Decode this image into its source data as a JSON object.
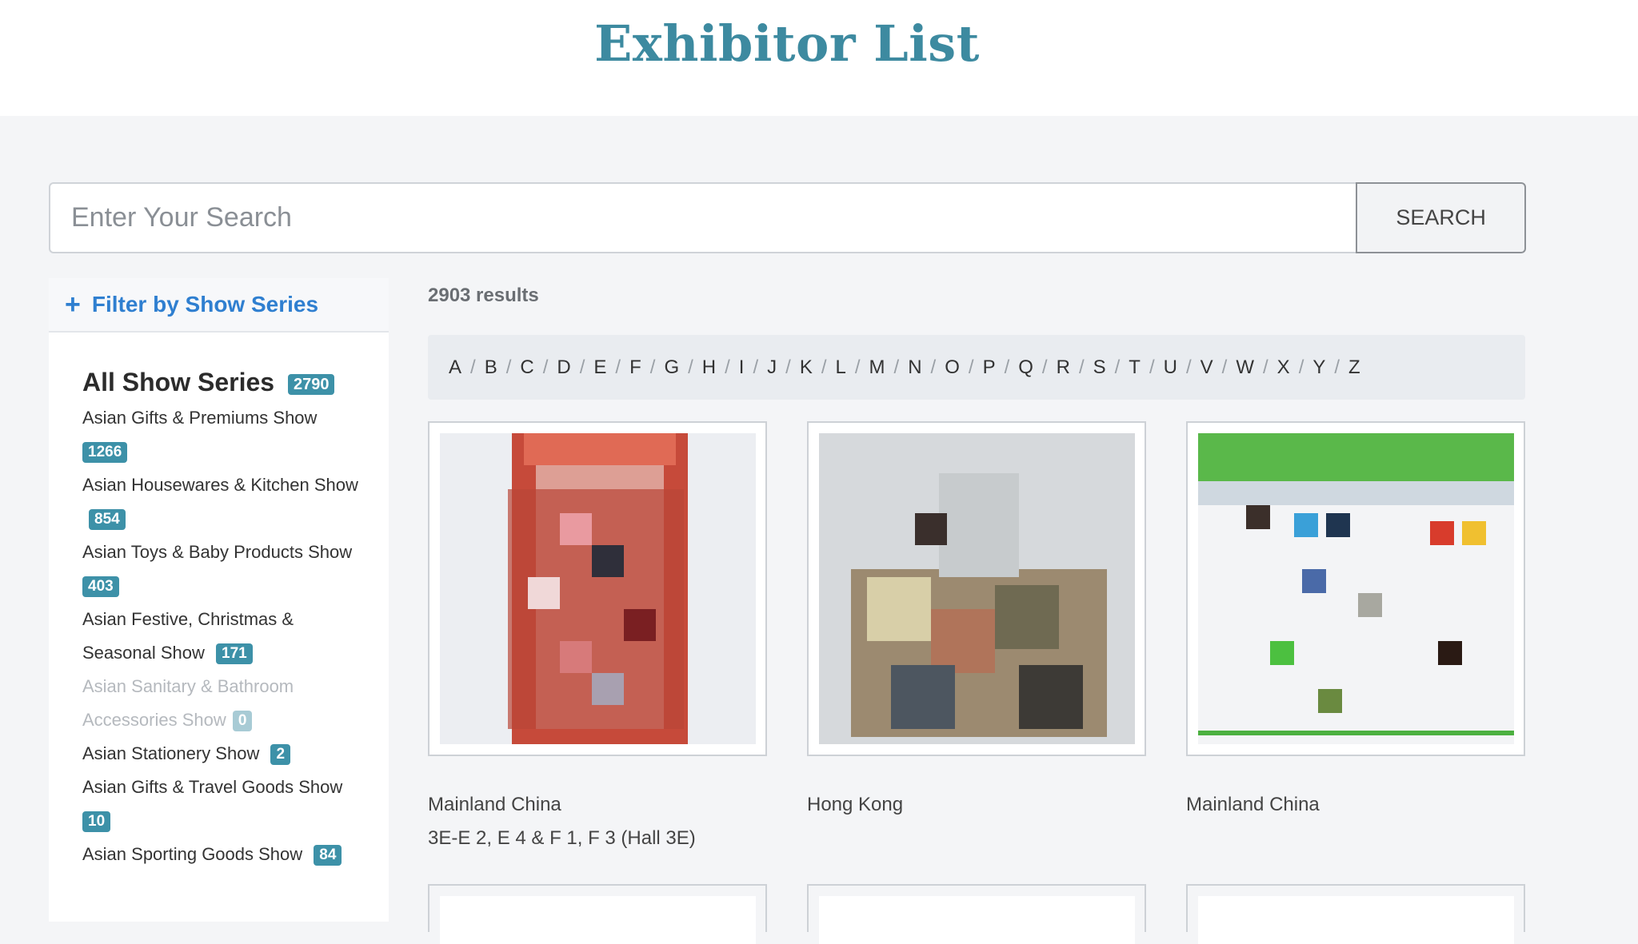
{
  "header": {
    "title": "Exhibitor List"
  },
  "search": {
    "placeholder": "Enter Your Search",
    "button_label": "SEARCH"
  },
  "sidebar": {
    "filter_label": "Filter by Show Series",
    "all_series": {
      "label": "All Show Series",
      "count": "2790"
    },
    "series": [
      {
        "label": "Asian Gifts & Premiums Show",
        "count": "1266"
      },
      {
        "label": "Asian Housewares & Kitchen Show",
        "count": "854"
      },
      {
        "label": "Asian Toys & Baby Products Show",
        "count": "403"
      },
      {
        "label": "Asian Festive, Christmas & Seasonal Show",
        "count": "171"
      },
      {
        "label": "Asian Sanitary & Bathroom Accessories Show",
        "count": "0"
      },
      {
        "label": "Asian Stationery Show",
        "count": "2"
      },
      {
        "label": "Asian Gifts & Travel Goods Show",
        "count": "10"
      },
      {
        "label": "Asian Sporting Goods Show",
        "count": "84"
      }
    ]
  },
  "results": {
    "count_text": "2903 results"
  },
  "alphabet": [
    "A",
    "B",
    "C",
    "D",
    "E",
    "F",
    "G",
    "H",
    "I",
    "J",
    "K",
    "L",
    "M",
    "N",
    "O",
    "P",
    "Q",
    "R",
    "S",
    "T",
    "U",
    "V",
    "W",
    "X",
    "Y",
    "Z"
  ],
  "cards": [
    {
      "region": "Mainland China",
      "booth": "3E-E 2, E 4 & F 1, F 3 (Hall 3E)"
    },
    {
      "region": "Hong Kong",
      "booth": ""
    },
    {
      "region": "Mainland China",
      "booth": ""
    }
  ],
  "colors": {
    "accent": "#3d8aa0",
    "link": "#2f7fd0",
    "badge": "#3d91a8"
  }
}
